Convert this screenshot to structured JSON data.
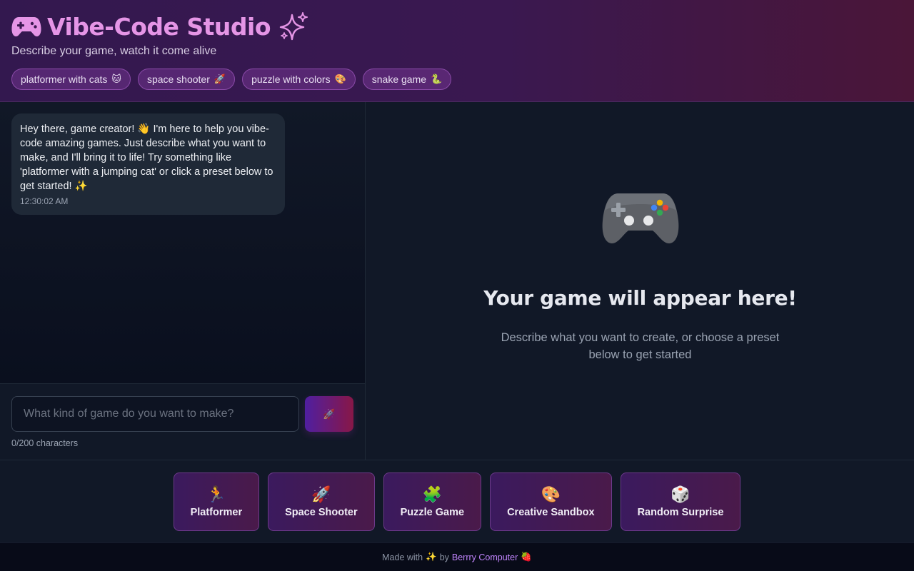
{
  "header": {
    "title": "Vibe-Code Studio",
    "subtitle": "Describe your game, watch it come alive",
    "chips": [
      {
        "label": "platformer with cats",
        "emoji": "🐱"
      },
      {
        "label": "space shooter",
        "emoji": "🚀"
      },
      {
        "label": "puzzle with colors",
        "emoji": "🎨"
      },
      {
        "label": "snake game",
        "emoji": "🐍"
      }
    ]
  },
  "chat": {
    "message": "Hey there, game creator! 👋 I'm here to help you vibe-code amazing games. Just describe what you want to make, and I'll bring it to life! Try something like 'platformer with a jumping cat' or click a preset below to get started! ✨",
    "timestamp": "12:30:02 AM",
    "input_placeholder": "What kind of game do you want to make?",
    "input_value": "",
    "send_emoji": "🚀",
    "char_count": "0/200 characters"
  },
  "preview": {
    "icon": "gamepad-icon",
    "title": "Your game will appear here!",
    "description": "Describe what you want to create, or choose a preset below to get started"
  },
  "presets": [
    {
      "emoji": "🏃",
      "label": "Platformer"
    },
    {
      "emoji": "🚀",
      "label": "Space Shooter"
    },
    {
      "emoji": "🧩",
      "label": "Puzzle Game"
    },
    {
      "emoji": "🎨",
      "label": "Creative Sandbox"
    },
    {
      "emoji": "🎲",
      "label": "Random Surprise"
    }
  ],
  "footer": {
    "made_with": "Made with",
    "sparkle": "✨",
    "by": "by",
    "link": "Berrry Computer",
    "berry": "🍓"
  },
  "colors": {
    "accent": "#e595e6",
    "link": "#c084fc",
    "header_start": "#33184f",
    "header_end": "#4a1638"
  }
}
